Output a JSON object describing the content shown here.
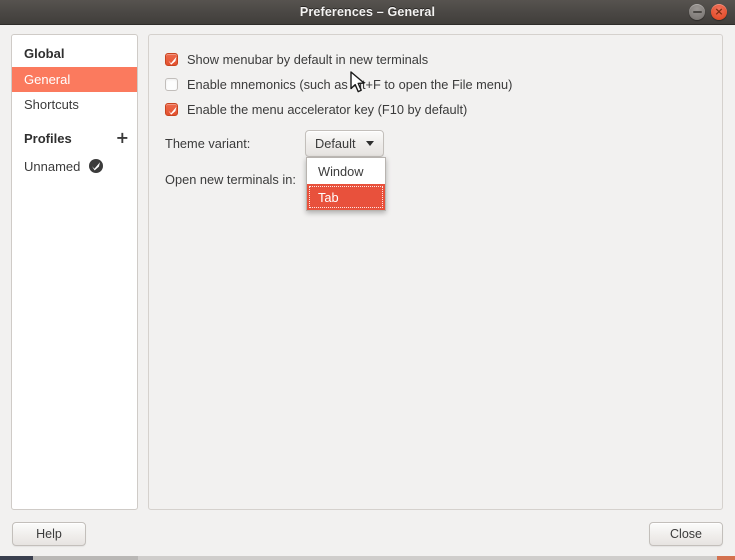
{
  "window": {
    "title": "Preferences – General",
    "minimize_icon": "minimize-icon",
    "close_icon": "close-icon",
    "close_glyph": "×",
    "minimize_glyph": "–"
  },
  "colors": {
    "accent": "#e8513c",
    "selection": "#fb7a5e",
    "checkbox_on": "#e4512f",
    "titlebar": "#4b4845",
    "panel_bg": "#f2f1f0",
    "sidebar_bg": "#ffffff"
  },
  "sidebar": {
    "items": [
      {
        "label": "Global",
        "type": "header",
        "selected": false
      },
      {
        "label": "General",
        "type": "item",
        "selected": true
      },
      {
        "label": "Shortcuts",
        "type": "item",
        "selected": false
      },
      {
        "label": "Profiles",
        "type": "header",
        "selected": false,
        "action_icon": "plus-icon",
        "action_glyph": "+"
      },
      {
        "label": "Unnamed",
        "type": "profile",
        "selected": false,
        "badge_icon": "default-profile-check-icon"
      }
    ]
  },
  "main": {
    "checkboxes": [
      {
        "label": "Show menubar by default in new terminals",
        "checked": true
      },
      {
        "label": "Enable mnemonics (such as Alt+F to open the File menu)",
        "checked": false
      },
      {
        "label": "Enable the menu accelerator key (F10 by default)",
        "checked": true
      }
    ],
    "fields": [
      {
        "label": "Theme variant:",
        "value": "Default",
        "icon": "chevron-down-icon"
      },
      {
        "label": "Open new terminals in:",
        "value": "Tab",
        "icon": "chevron-down-icon"
      }
    ],
    "open_dropdown": {
      "belongs_to": "Open new terminals in:",
      "options": [
        {
          "label": "Window",
          "highlighted": false
        },
        {
          "label": "Tab",
          "highlighted": true
        }
      ]
    },
    "cursor": "mouse-pointer-icon"
  },
  "actions": {
    "help_label": "Help",
    "close_label": "Close"
  }
}
